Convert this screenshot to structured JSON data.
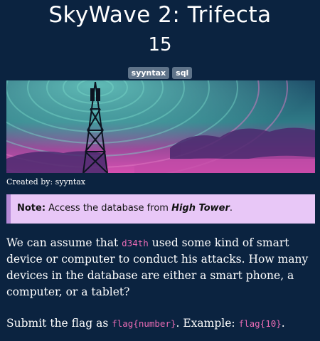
{
  "challenge": {
    "title": "SkyWave 2: Trifecta",
    "points": "15",
    "tags": [
      "syyntax",
      "sql"
    ],
    "created_by": "Created by: syyntax"
  },
  "note": {
    "label": "Note:",
    "text_before": " Access the database from ",
    "emphasis": "High Tower",
    "text_after": "."
  },
  "description": {
    "p1_before": "We can assume that ",
    "p1_code": "d34th",
    "p1_after": " used some kind of smart device or computer to conduct his attacks. How many devices in the database are either a smart phone, a computer, or a tablet?",
    "p2_before": "Submit the flag as ",
    "p2_code1": "flag{number}",
    "p2_middle": ". Example: ",
    "p2_code2": "flag{10}",
    "p2_after": "."
  },
  "colors": {
    "background": "#0b2340",
    "note_bg": "#e8c7f7",
    "code": "#e86bb4"
  }
}
